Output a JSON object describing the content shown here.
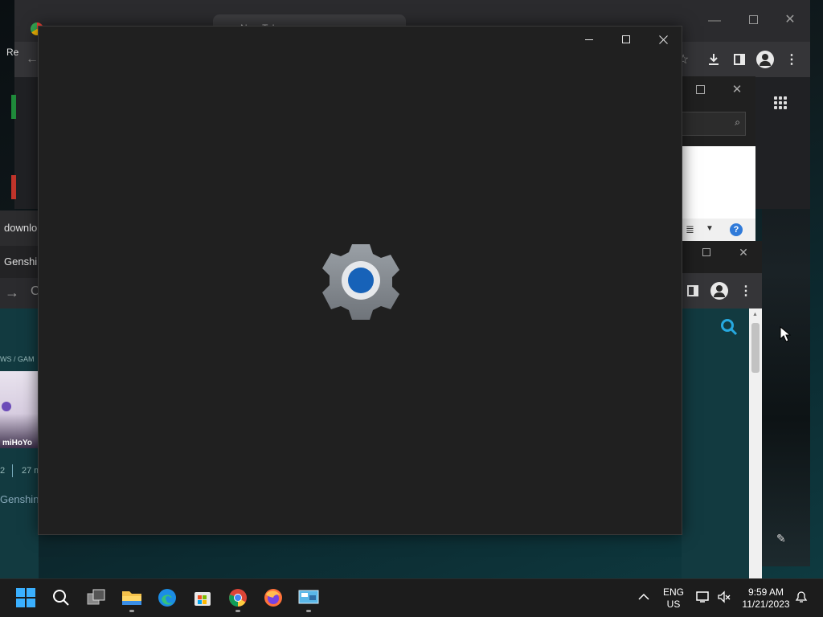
{
  "background_chrome": {
    "tab_title": "New Tab",
    "icons": [
      "back-arrow-icon",
      "star-icon",
      "download-icon",
      "side-panel-icon",
      "profile-icon",
      "more-vert-icon",
      "apps-grid-icon"
    ],
    "left_label": "Re"
  },
  "left_windows": {
    "window_a_title": "downlo",
    "window_b_title": "Genshin",
    "breadcrumb": "WS / GAM",
    "publisher": "miHoYo",
    "meta_num": "2",
    "meta_time": "27 m",
    "article_snippet": "Genshin"
  },
  "explorer": {
    "help_label": "?"
  },
  "settings_window": {
    "title": "",
    "icon": "settings-gear-icon",
    "controls": [
      "minimize",
      "maximize",
      "close"
    ],
    "colors": {
      "background": "#202020",
      "gear": "#8e9298",
      "gear_center": "#1762b8"
    }
  },
  "taskbar": {
    "apps": [
      {
        "name": "start",
        "icon": "windows-logo-icon"
      },
      {
        "name": "search",
        "icon": "search-icon"
      },
      {
        "name": "task-view",
        "icon": "task-view-icon"
      },
      {
        "name": "file-explorer",
        "icon": "folder-icon",
        "running": true
      },
      {
        "name": "edge",
        "icon": "edge-icon"
      },
      {
        "name": "store",
        "icon": "store-icon"
      },
      {
        "name": "chrome",
        "icon": "chrome-icon",
        "running": true
      },
      {
        "name": "firefox",
        "icon": "firefox-icon"
      },
      {
        "name": "control-panel",
        "icon": "control-panel-icon",
        "running": true
      }
    ],
    "language_line1": "ENG",
    "language_line2": "US",
    "time": "9:59 AM",
    "date": "11/21/2023"
  }
}
